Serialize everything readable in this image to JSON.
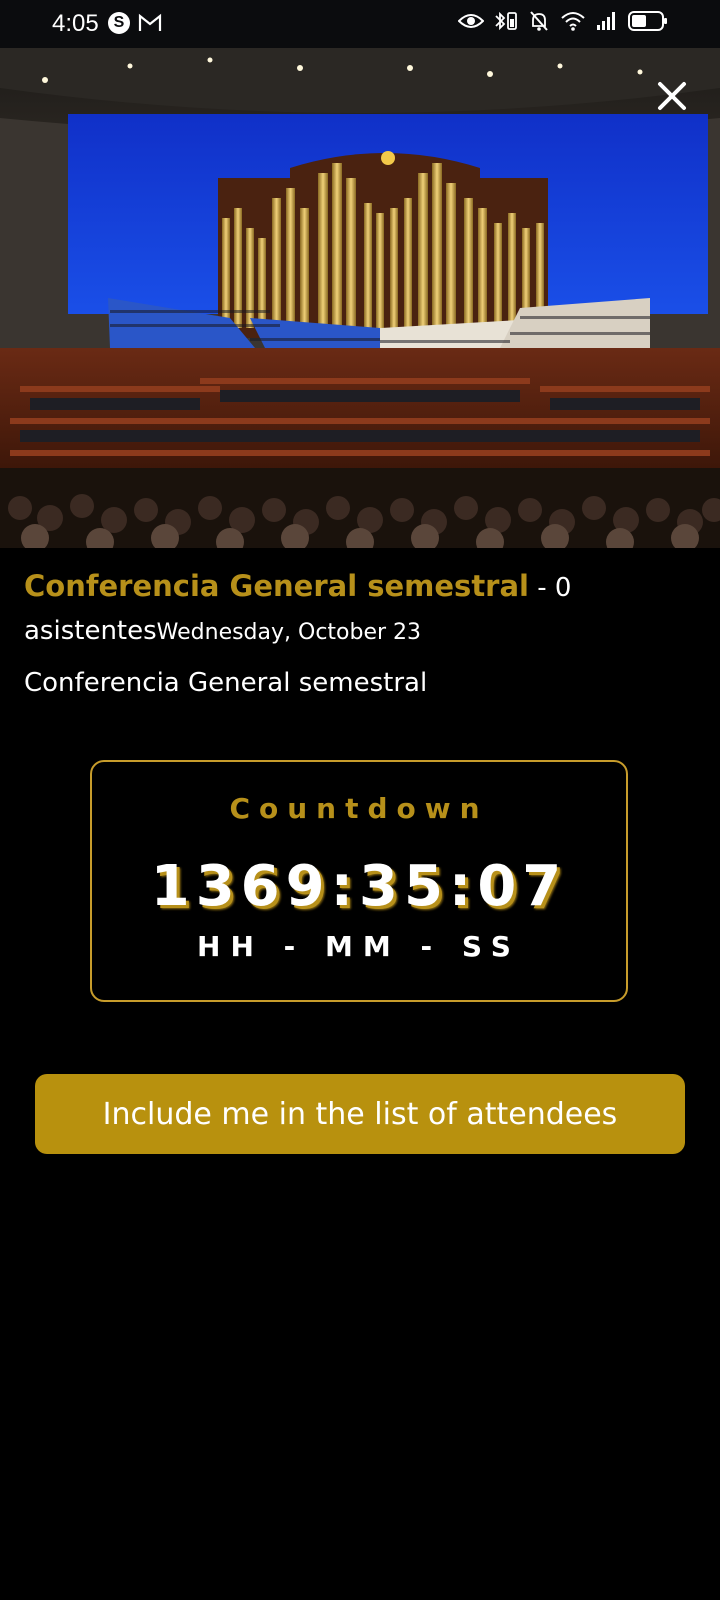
{
  "status_bar": {
    "time": "4:05",
    "left_icons": [
      "s-app-icon",
      "gmail-icon"
    ],
    "right_icons": [
      "eye-icon",
      "bluetooth-battery-icon",
      "mute-bell-icon",
      "wifi-icon",
      "signal-icon",
      "battery-icon"
    ]
  },
  "hero": {
    "image": "conference-center-choir-organ-photo"
  },
  "event": {
    "title": "Conferencia General semestral",
    "attendees": " - 0 asistentes",
    "date": "Wednesday, October 23",
    "description": "Conferencia General semestral"
  },
  "countdown": {
    "title": "Countdown",
    "value": "1369:35:07",
    "units": "HH - MM - SS"
  },
  "attend_button": {
    "label": "Include me in the list of attendees"
  },
  "colors": {
    "accent": "#b8910e",
    "background": "#000000"
  }
}
